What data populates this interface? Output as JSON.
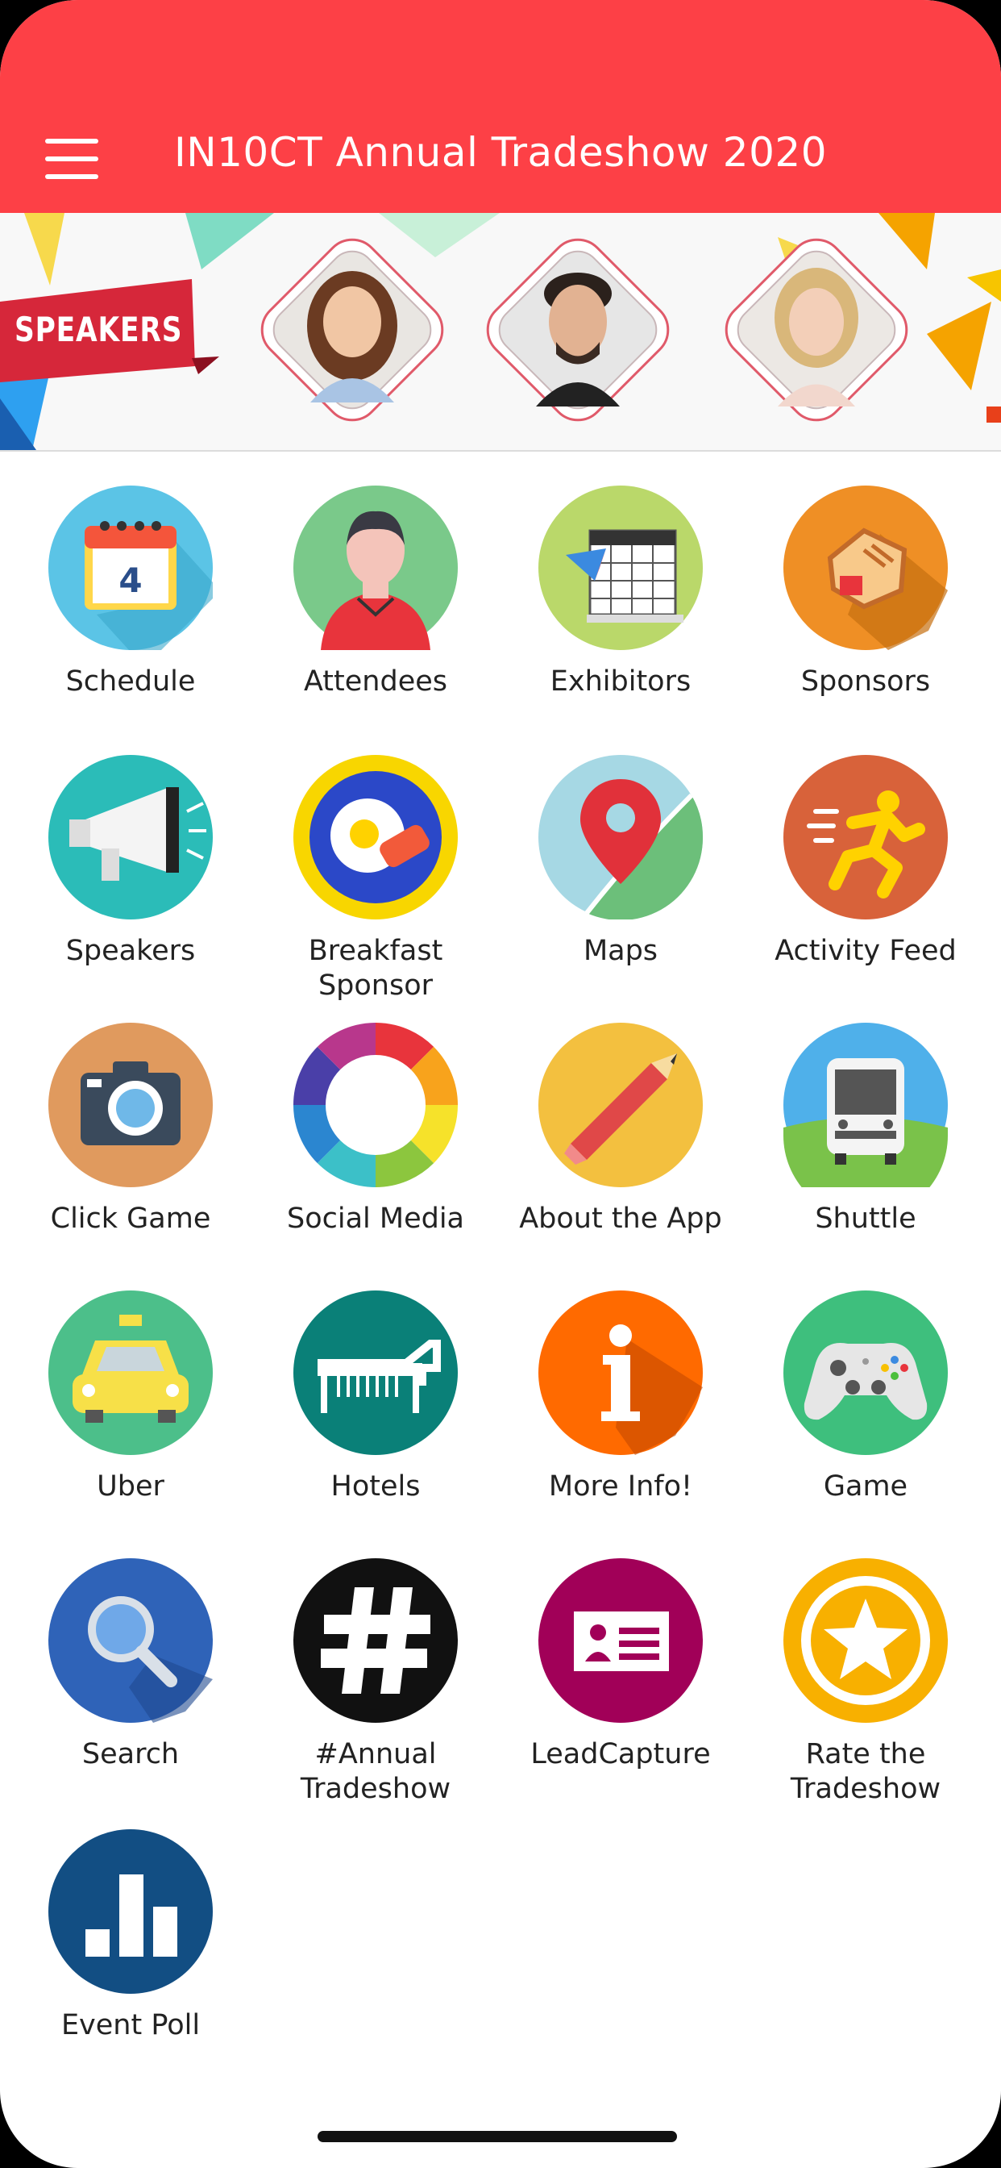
{
  "header": {
    "title": "IN10CT Annual Tradeshow 2020",
    "background_color": "#fd4046",
    "menu_icon": "hamburger-menu-icon"
  },
  "banner": {
    "label": "SPEAKERS",
    "speakers_count": 3
  },
  "grid": {
    "items": [
      {
        "label": "Schedule",
        "icon": "calendar-icon",
        "color": "#5bc4e6"
      },
      {
        "label": "Attendees",
        "icon": "person-icon",
        "color": "#7ac98a"
      },
      {
        "label": "Exhibitors",
        "icon": "calendar-grid-icon",
        "color": "#bad86a"
      },
      {
        "label": "Sponsors",
        "icon": "handshake-icon",
        "color": "#ef8f25"
      },
      {
        "label": "Speakers",
        "icon": "megaphone-icon",
        "color": "#2bbcb8"
      },
      {
        "label": "Breakfast Sponsor",
        "icon": "egg-bacon-icon",
        "color": "#f8d600"
      },
      {
        "label": "Maps",
        "icon": "map-pin-icon",
        "color": "#a6d8e4"
      },
      {
        "label": "Activity Feed",
        "icon": "runner-icon",
        "color": "#d8623a"
      },
      {
        "label": "Click Game",
        "icon": "camera-icon",
        "color": "#e09a5e"
      },
      {
        "label": "Social Media",
        "icon": "color-ring-icon",
        "color": "#ffffff"
      },
      {
        "label": "About the App",
        "icon": "pencil-icon",
        "color": "#f3c03f"
      },
      {
        "label": "Shuttle",
        "icon": "bus-icon",
        "color": "#4fb0ea"
      },
      {
        "label": "Uber",
        "icon": "taxi-icon",
        "color": "#4cbf8a"
      },
      {
        "label": "Hotels",
        "icon": "bed-icon",
        "color": "#0a8078"
      },
      {
        "label": "More Info!",
        "icon": "info-icon",
        "color": "#ff6a00"
      },
      {
        "label": "Game",
        "icon": "gamepad-icon",
        "color": "#3ebf7d"
      },
      {
        "label": "Search",
        "icon": "magnifier-icon",
        "color": "#2f63b8"
      },
      {
        "label": "#Annual Tradeshow",
        "icon": "hashtag-icon",
        "color": "#111111"
      },
      {
        "label": "LeadCapture",
        "icon": "id-card-icon",
        "color": "#a10058"
      },
      {
        "label": "Rate the Tradeshow",
        "icon": "star-icon",
        "color": "#f8b000"
      },
      {
        "label": "Event Poll",
        "icon": "bar-chart-icon",
        "color": "#124e83"
      }
    ]
  }
}
